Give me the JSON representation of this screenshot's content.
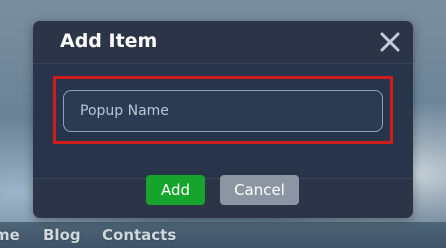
{
  "background": {
    "nav_links": [
      "me",
      "Blog",
      "Contacts"
    ]
  },
  "dialog": {
    "title": "Add Item",
    "close_icon": "close-icon",
    "input": {
      "value": "",
      "placeholder": "Popup Name"
    },
    "buttons": {
      "add_label": "Add",
      "cancel_label": "Cancel"
    }
  },
  "colors": {
    "dialog_background": "#2b3547",
    "dialog_body": "#27344a",
    "highlight_border": "#d01c1c",
    "add_button": "#17a42c",
    "cancel_button": "#8b96a2",
    "input_border": "#8aa3c2"
  }
}
